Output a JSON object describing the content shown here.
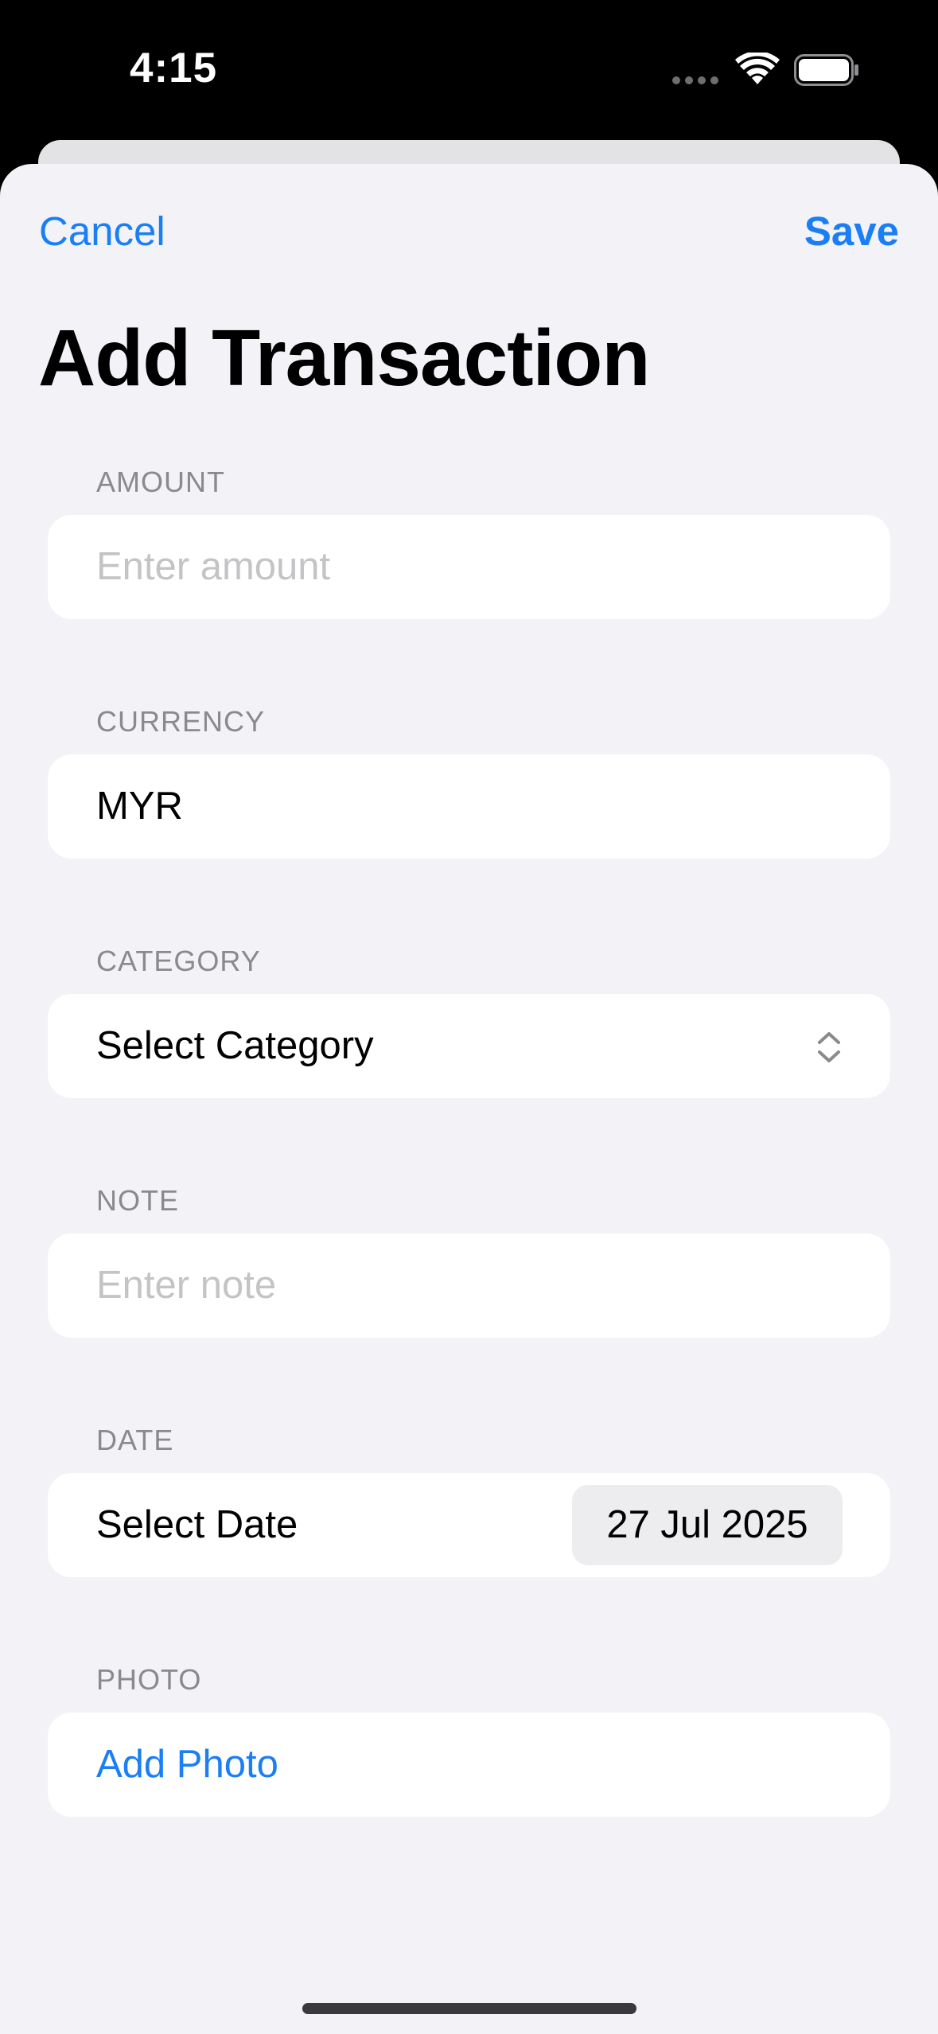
{
  "status_bar": {
    "time": "4:15",
    "icons": [
      "signal-dots-icon",
      "wifi-icon",
      "battery-icon"
    ]
  },
  "nav": {
    "cancel_label": "Cancel",
    "save_label": "Save"
  },
  "title": "Add Transaction",
  "form": {
    "amount": {
      "label": "AMOUNT",
      "value": "",
      "placeholder": "Enter amount"
    },
    "currency": {
      "label": "CURRENCY",
      "value": "MYR"
    },
    "category": {
      "label": "CATEGORY",
      "value": "Select Category",
      "icon": "chevron-up-down-icon"
    },
    "note": {
      "label": "NOTE",
      "value": "",
      "placeholder": "Enter note"
    },
    "date": {
      "label": "DATE",
      "row_label": "Select Date",
      "value": "27 Jul 2025"
    },
    "photo": {
      "label": "PHOTO",
      "action_label": "Add Photo"
    }
  },
  "colors": {
    "accent": "#1a7ef5",
    "sheet_background": "#f2f2f7",
    "field_background": "#ffffff",
    "section_label": "#8a8a8e",
    "placeholder": "#c4c4c7"
  }
}
